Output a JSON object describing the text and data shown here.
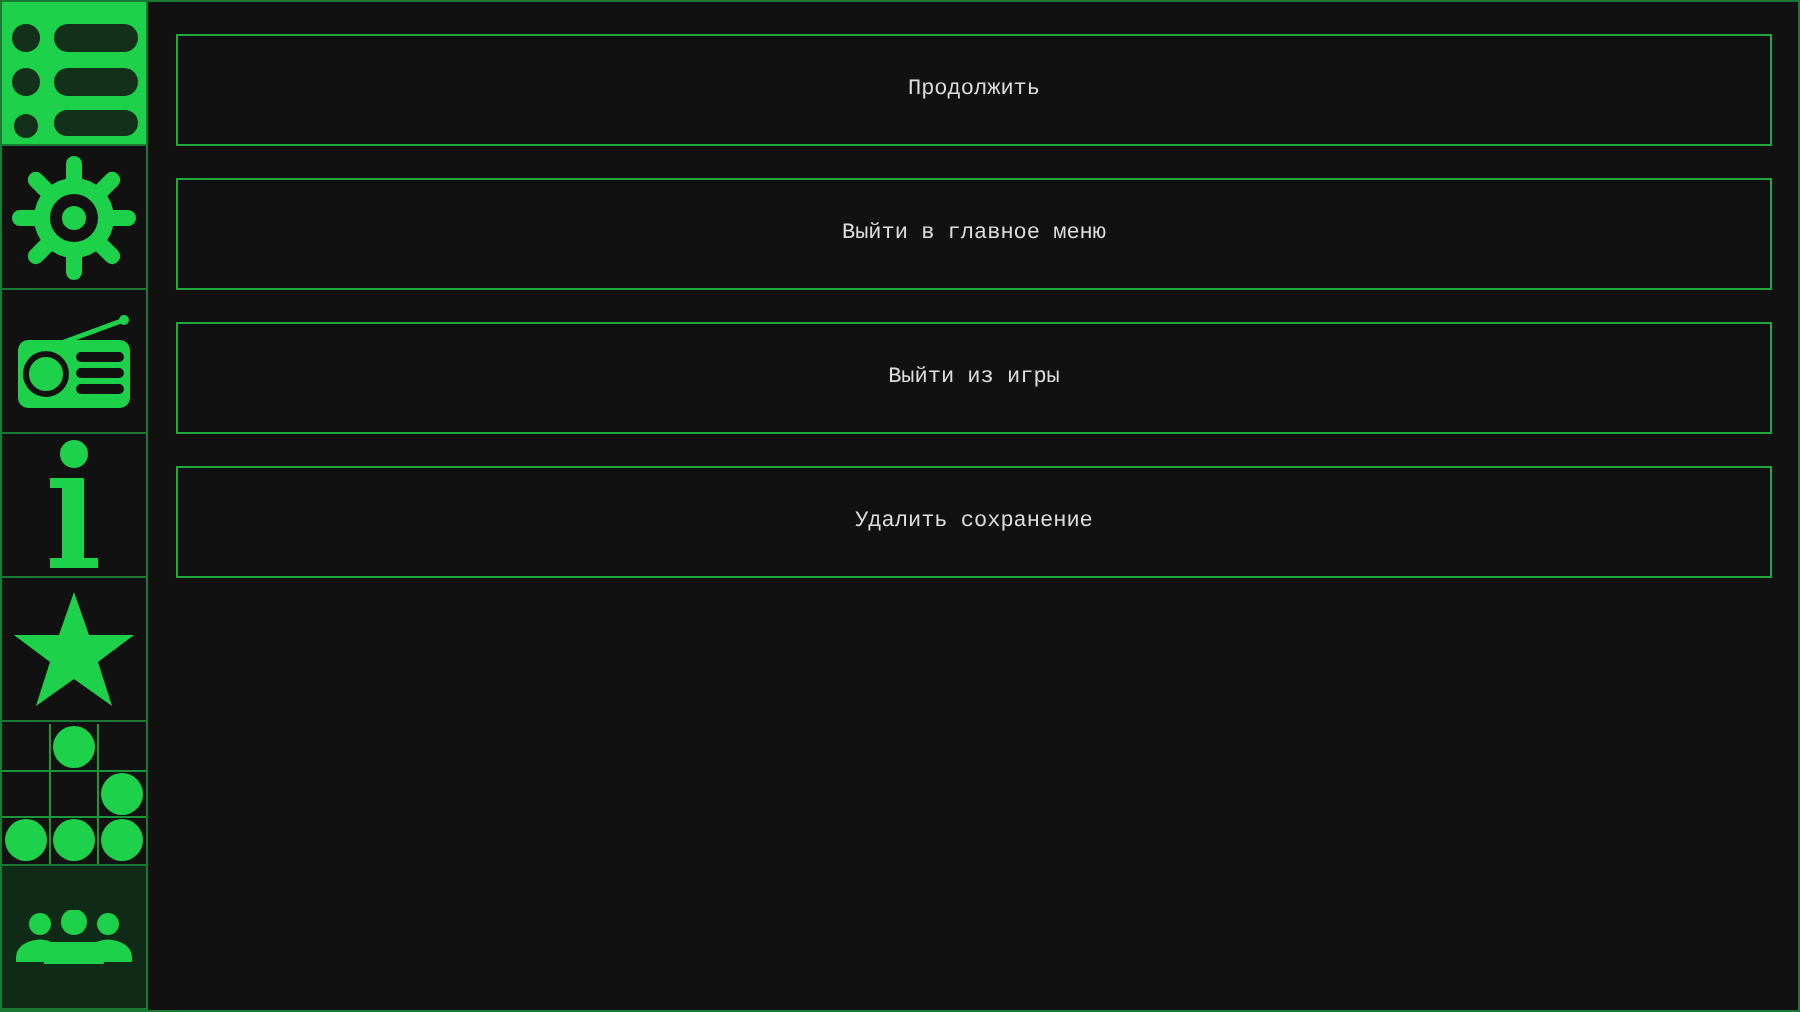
{
  "sidebar": {
    "tabs": [
      {
        "kind": "list",
        "selected": true,
        "hovered": false
      },
      {
        "kind": "gear",
        "selected": false,
        "hovered": false
      },
      {
        "kind": "radio",
        "selected": false,
        "hovered": false
      },
      {
        "kind": "info",
        "selected": false,
        "hovered": false
      },
      {
        "kind": "star",
        "selected": false,
        "hovered": false
      },
      {
        "kind": "grid",
        "selected": false,
        "hovered": false
      },
      {
        "kind": "people",
        "selected": false,
        "hovered": true
      }
    ]
  },
  "menu": {
    "buttons": [
      "Продолжить",
      "Выйти в главное меню",
      "Выйти из игры",
      "Удалить сохранение"
    ]
  }
}
